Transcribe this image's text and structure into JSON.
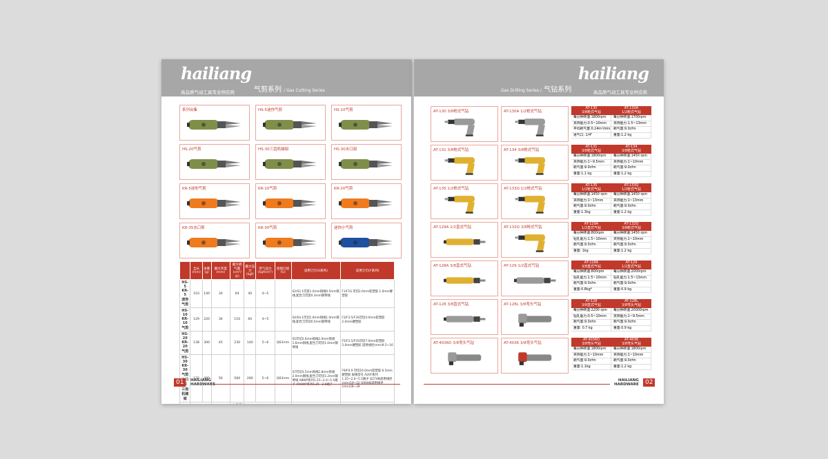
{
  "left": {
    "logo": "hailiang",
    "slogan": "高品质气动工具专业供应商",
    "series_cn": "气剪系列",
    "series_en": "/ Gas Cutting Series",
    "tiles": [
      "系列合集",
      "HS-5迷你气剪",
      "HS-10气剪",
      "HS-20气剪",
      "HS-30三齿机械钳",
      "HS-30水口钳",
      "KR-5迷你气剪",
      "KR-10气剪",
      "KR-20气剪",
      "KR-35水口剪",
      "KR-30气剪",
      "迷你小气剪"
    ],
    "table": {
      "headers": [
        "",
        "全长(mm)",
        "净重(g)",
        "最大开度(mm)",
        "最大耗气量(cm³/分)",
        "最大压力(kgf)",
        "空气压力(kgf/cm²)",
        "连接口径(G)",
        "适用刀刃(S系列)",
        "适用刀刃(F系列)"
      ],
      "rows": [
        [
          "HS-5\nKR-5\n迷你气剪",
          "103",
          "140",
          "30",
          "64",
          "40",
          "4~5",
          "",
          "S2/S2.1可剪1.0mm铜线0.5mm铁线,配合刀可剪0.3mm钢琴线",
          "F1/F1S 可切2.0mm软塑胶 1.0mm硬塑胶"
        ],
        [
          "HS-10\nKR-10\n气剪",
          "129",
          "220",
          "36",
          "116",
          "60",
          "4~5",
          "",
          "S4/S4.1可切1.6mm铜线1.0mm铁线,配合刀可切0.5mm钢琴线",
          "F3/F3.5/F3S可切4.0mm软塑胶 2.0mm硬塑胶"
        ],
        [
          "HS-20\nKR-20\n气剪",
          "138",
          "300",
          "45",
          "230",
          "140",
          "5~6",
          "Q63mm",
          "S5可切2.6mm铜线2.0mm铁线1.6mm铜线,配合刀可切1.0mm钢琴线",
          "F5/F5.5/F5S可切7.0mm软塑胶5.0mm硬塑胶 适用线径(mm)9.5~16"
        ],
        [
          "HS-30\nKR-30\n气剪\n水口钳\n三齿机械钳",
          "170",
          "490",
          "56",
          "584",
          "280",
          "5~6",
          "Q63mm",
          "S7可切3.5mm铜线2.8mm铁线2.0mm钢线,配合刀可切1.2mm钢琴线 ABWP系列1.25~2.0~5.5端子 AR8WP系列1.25~2.0端子",
          "F9/F9.9 可切10.0mm软塑胶 6.5mm硬塑胶 规格型号 A20F系列1.25~2.0~5.5端子 Q27HN适用线径(mm)19~22 Q99HN适用线径(mm)28~39"
        ]
      ],
      "last": [
        "迷你气剪",
        "剪切厚度 2mm",
        "空转转速 3500rpm",
        "入气接头 1/4\" N.P.T",
        "空气压力 2500",
        "总长度 150mm",
        "剪刀长度 80mm",
        "力矩剪刀时最大厚度17mm"
      ]
    },
    "page_num": "01",
    "brand1": "HAILIANG",
    "brand2": "HARDWARE"
  },
  "right": {
    "logo": "hailiang",
    "slogan": "高品质气动工具专业供应商",
    "series_cn": "气钻系列",
    "series_en": "Gas Drilling Series /",
    "tiles": [
      "AT-130  3/8枪式气钻",
      "AT-130A  1/2枪式气钻",
      "AT-131  3/8枪式气钻",
      "AT-134  3/8枪式气钻",
      "AT-135  1/2枪式气钻",
      "AT-133Q  1/2枪式气钻",
      "AT-129A  1/2直式气钻",
      "AT-132Q  3/8枪式气钻",
      "AT-128A  3/8直式气钻",
      "AT-129  1/2直式气钻",
      "AT-128  3/8直式气钻",
      "AT-128L  3/8弯头气钻",
      "AT-4036D  3/8弯头气钻",
      "AT-4036  3/8弯头气钻"
    ],
    "specs": [
      {
        "h1": "AT-130\n3/8枪式气钻",
        "h2": "AT-130A\n1/2枪式气钻",
        "rows": [
          [
            "每分钟转速:1800rpm",
            "每分钟转速:1700rpm"
          ],
          [
            "夹持能力:0.5~10mm",
            "夹持能力:1.5~13mm"
          ],
          [
            "平均耗气量:0.24m³/min",
            "耗气量:9.0cfm"
          ],
          [
            "进气口: 1/4\"",
            "重量:1.2 kg"
          ]
        ]
      },
      {
        "h1": "AT-131\n3/8枪式气钻",
        "h2": "AT-134\n3/8枪式气钻",
        "rows": [
          [
            "每分钟转速:1800rpm",
            "每分钟转速:1450 rpm"
          ],
          [
            "夹持能力:1~9.5mm",
            "夹持能力:1~10mm"
          ],
          [
            "耗气量:9.0cfm",
            "耗气量:9.0cfm"
          ],
          [
            "重量:1.1 kg",
            "重量:1.2 kg"
          ]
        ]
      },
      {
        "h1": "AT-135\n1/2枪式气钻",
        "h2": "AT-133Q\n1/2枪式气钻",
        "rows": [
          [
            "每分钟转速:1450 rpm",
            "每分钟转速:1450 rpm"
          ],
          [
            "夹持能力:1~13mm",
            "夹持能力:1~13mm"
          ],
          [
            "耗气量:9.0cfm",
            "耗气量:9.0cfm"
          ],
          [
            "重量:1.3kg",
            "重量:1.2 kg"
          ]
        ]
      },
      {
        "h1": "AT-129A\n1/2直式气钻",
        "h2": "AT-132Q\n3/8枪式气钻",
        "rows": [
          [
            "每分钟转速:800rpm",
            "每分钟转速:1450 rpm"
          ],
          [
            "钻孔能力:1.5~10mm",
            "夹持能力:1~10mm"
          ],
          [
            "耗气量:9.0cfm",
            "耗气量:9.0cfm"
          ],
          [
            "重量: 1kg",
            "重量:1.2 kg"
          ]
        ]
      },
      {
        "h1": "AT-128A\n3/8直式气钻",
        "h2": "AT-129\n1/2直式气钻",
        "rows": [
          [
            "每分钟转速:800rpm",
            "每分钟转速:2000rpm"
          ],
          [
            "钻孔能力:1.5~10mm",
            "钻孔能力:1.5~13mm"
          ],
          [
            "耗气量:9.0cfm",
            "耗气量:9.0cfm"
          ],
          [
            "重量:0.8kg*",
            "重量:0.9 kg"
          ]
        ]
      },
      {
        "h1": "AT-128\n3/8直式气钻",
        "h2": "AT-128L\n3/8弯头气钻",
        "rows": [
          [
            "每分钟转速:2200 rpm",
            "每分钟转速:20000rpm"
          ],
          [
            "钻孔能力:0.5~10mm",
            "夹持能力:1~9.5mm"
          ],
          [
            "耗气量:9.0cfm",
            "耗气量:9.0cfm"
          ],
          [
            "重量: 0.7 kg",
            "重量:0.9 kg"
          ]
        ]
      },
      {
        "h1": "AT-4036D\n3/8弯头气钻",
        "h2": "AT-4036\n3/8弯头气钻",
        "rows": [
          [
            "每分钟转速:1800rpm",
            "每分钟转速:1800rpm"
          ],
          [
            "夹持能力:1~10mm",
            "夹持能力:1~10mm"
          ],
          [
            "耗气量:9.0cfm",
            "耗气量:9.0cfm"
          ],
          [
            "重量:1.1kg",
            "重量:1.2 kg"
          ]
        ]
      }
    ],
    "page_num": "02",
    "brand1": "HAILIANG",
    "brand2": "HARDWARE"
  },
  "colors": {
    "accent": "#c0392b",
    "header": "#a7a7a7",
    "shears": [
      "#7f8f4a",
      "#f07a1e",
      "#1f4fa0"
    ],
    "drills": [
      "#9a9a9a",
      "#e0b030",
      "#c0392b"
    ]
  }
}
